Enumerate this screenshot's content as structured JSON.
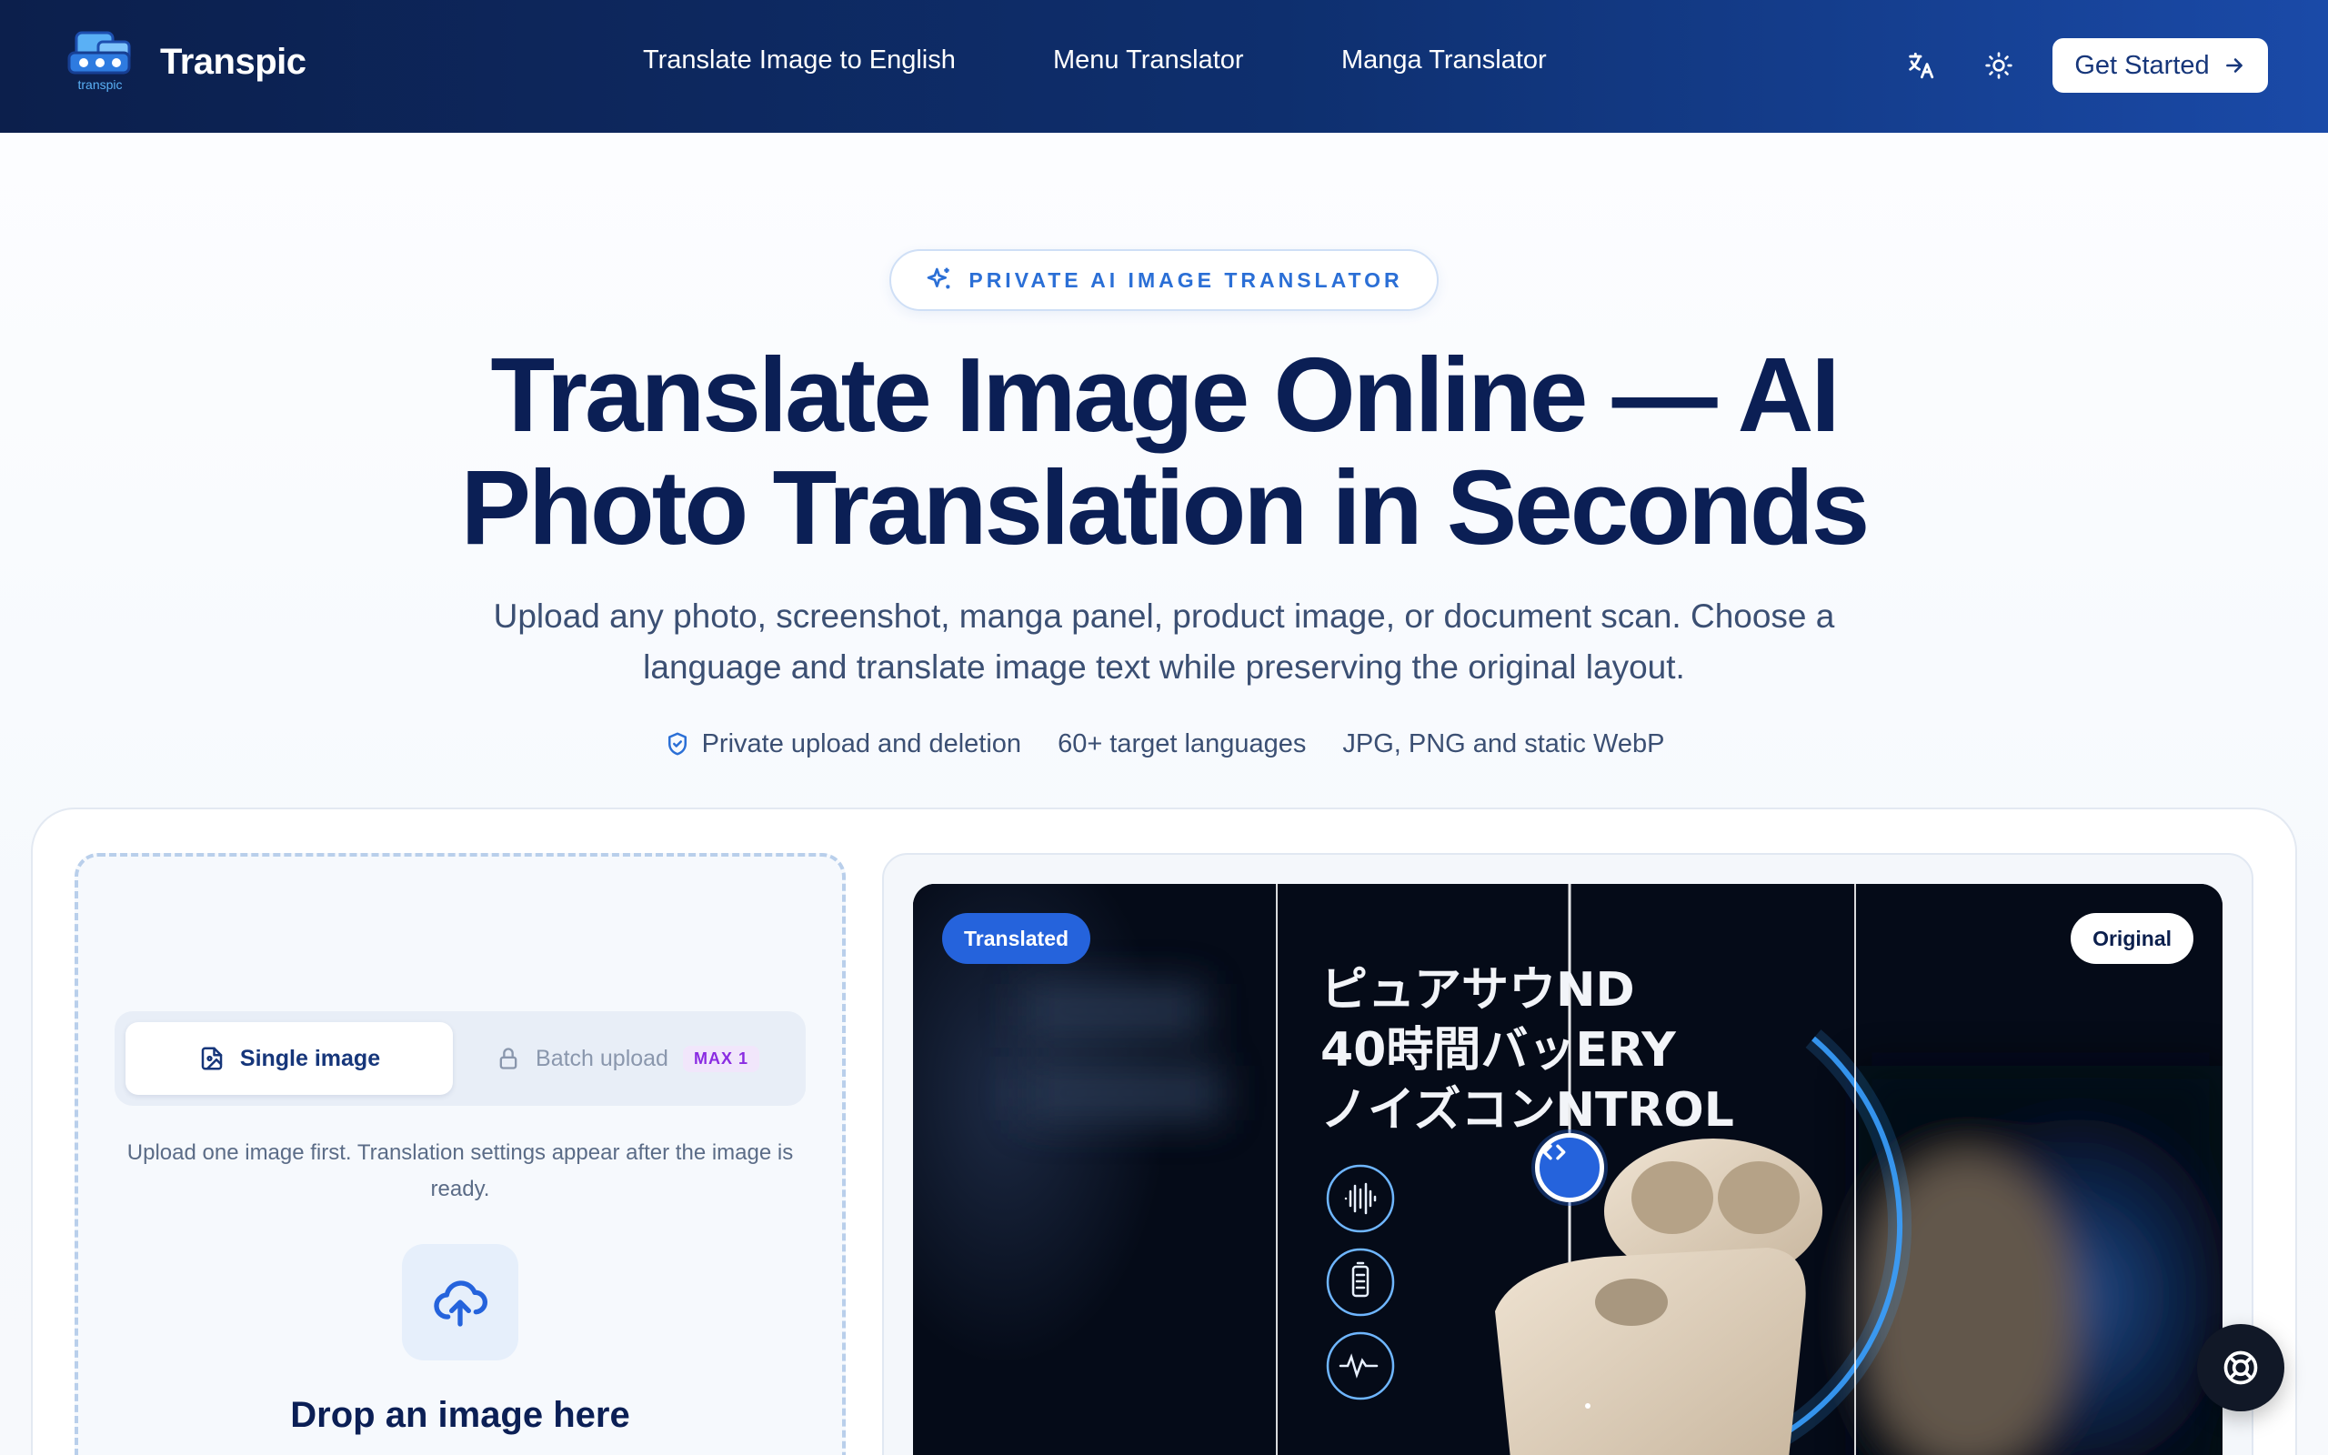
{
  "brand": {
    "name": "Transpic",
    "logo_text": "transpic"
  },
  "nav": {
    "links": [
      "Translate Image to English",
      "Menu Translator",
      "Manga Translator"
    ],
    "translate_icon": "translate-icon",
    "theme_icon": "sun-icon",
    "cta_label": "Get Started"
  },
  "hero": {
    "badge": "PRIVATE AI IMAGE TRANSLATOR",
    "title": "Translate Image Online — AI Photo Translation in Seconds",
    "subtitle": "Upload any photo, screenshot, manga panel, product image, or document scan. Choose a language and translate image text while preserving the original layout.",
    "features": [
      "Private upload and deletion",
      "60+ target languages",
      "JPG, PNG and static WebP"
    ]
  },
  "upload": {
    "mode_single": "Single image",
    "mode_batch": "Batch upload",
    "batch_badge": "MAX 1",
    "hint": "Upload one image first. Translation settings appear after the image is ready.",
    "drop_title": "Drop an image here"
  },
  "preview": {
    "translated_label": "Translated",
    "original_label": "Original",
    "text_lines": [
      "ピュアサウNDND",
      "40時間バッERY",
      "ノイズコンNTROL"
    ],
    "visible_lines": [
      "ピュアサウ",
      "ND",
      "40時間バッ",
      "ERY",
      "ノイズコン",
      "NTROL"
    ]
  },
  "colors": {
    "header_start": "#0c1f4c",
    "header_end": "#1a4aa8",
    "accent": "#2563dc",
    "title": "#0b1f55",
    "batch_badge": "#8a2be2"
  }
}
